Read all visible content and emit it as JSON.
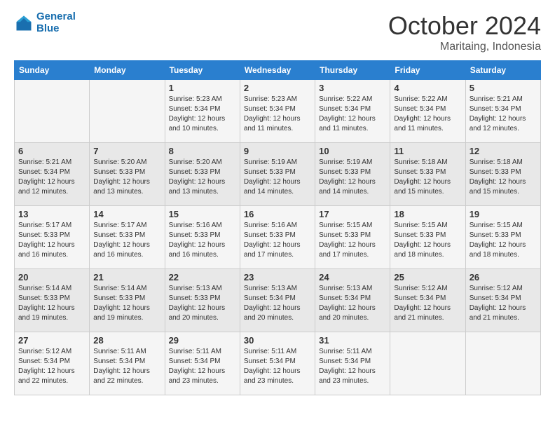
{
  "header": {
    "logo_line1": "General",
    "logo_line2": "Blue",
    "month": "October 2024",
    "location": "Maritaing, Indonesia"
  },
  "weekdays": [
    "Sunday",
    "Monday",
    "Tuesday",
    "Wednesday",
    "Thursday",
    "Friday",
    "Saturday"
  ],
  "weeks": [
    [
      {
        "day": "",
        "sunrise": "",
        "sunset": "",
        "daylight": ""
      },
      {
        "day": "",
        "sunrise": "",
        "sunset": "",
        "daylight": ""
      },
      {
        "day": "1",
        "sunrise": "Sunrise: 5:23 AM",
        "sunset": "Sunset: 5:34 PM",
        "daylight": "Daylight: 12 hours and 10 minutes."
      },
      {
        "day": "2",
        "sunrise": "Sunrise: 5:23 AM",
        "sunset": "Sunset: 5:34 PM",
        "daylight": "Daylight: 12 hours and 11 minutes."
      },
      {
        "day": "3",
        "sunrise": "Sunrise: 5:22 AM",
        "sunset": "Sunset: 5:34 PM",
        "daylight": "Daylight: 12 hours and 11 minutes."
      },
      {
        "day": "4",
        "sunrise": "Sunrise: 5:22 AM",
        "sunset": "Sunset: 5:34 PM",
        "daylight": "Daylight: 12 hours and 11 minutes."
      },
      {
        "day": "5",
        "sunrise": "Sunrise: 5:21 AM",
        "sunset": "Sunset: 5:34 PM",
        "daylight": "Daylight: 12 hours and 12 minutes."
      }
    ],
    [
      {
        "day": "6",
        "sunrise": "Sunrise: 5:21 AM",
        "sunset": "Sunset: 5:34 PM",
        "daylight": "Daylight: 12 hours and 12 minutes."
      },
      {
        "day": "7",
        "sunrise": "Sunrise: 5:20 AM",
        "sunset": "Sunset: 5:33 PM",
        "daylight": "Daylight: 12 hours and 13 minutes."
      },
      {
        "day": "8",
        "sunrise": "Sunrise: 5:20 AM",
        "sunset": "Sunset: 5:33 PM",
        "daylight": "Daylight: 12 hours and 13 minutes."
      },
      {
        "day": "9",
        "sunrise": "Sunrise: 5:19 AM",
        "sunset": "Sunset: 5:33 PM",
        "daylight": "Daylight: 12 hours and 14 minutes."
      },
      {
        "day": "10",
        "sunrise": "Sunrise: 5:19 AM",
        "sunset": "Sunset: 5:33 PM",
        "daylight": "Daylight: 12 hours and 14 minutes."
      },
      {
        "day": "11",
        "sunrise": "Sunrise: 5:18 AM",
        "sunset": "Sunset: 5:33 PM",
        "daylight": "Daylight: 12 hours and 15 minutes."
      },
      {
        "day": "12",
        "sunrise": "Sunrise: 5:18 AM",
        "sunset": "Sunset: 5:33 PM",
        "daylight": "Daylight: 12 hours and 15 minutes."
      }
    ],
    [
      {
        "day": "13",
        "sunrise": "Sunrise: 5:17 AM",
        "sunset": "Sunset: 5:33 PM",
        "daylight": "Daylight: 12 hours and 16 minutes."
      },
      {
        "day": "14",
        "sunrise": "Sunrise: 5:17 AM",
        "sunset": "Sunset: 5:33 PM",
        "daylight": "Daylight: 12 hours and 16 minutes."
      },
      {
        "day": "15",
        "sunrise": "Sunrise: 5:16 AM",
        "sunset": "Sunset: 5:33 PM",
        "daylight": "Daylight: 12 hours and 16 minutes."
      },
      {
        "day": "16",
        "sunrise": "Sunrise: 5:16 AM",
        "sunset": "Sunset: 5:33 PM",
        "daylight": "Daylight: 12 hours and 17 minutes."
      },
      {
        "day": "17",
        "sunrise": "Sunrise: 5:15 AM",
        "sunset": "Sunset: 5:33 PM",
        "daylight": "Daylight: 12 hours and 17 minutes."
      },
      {
        "day": "18",
        "sunrise": "Sunrise: 5:15 AM",
        "sunset": "Sunset: 5:33 PM",
        "daylight": "Daylight: 12 hours and 18 minutes."
      },
      {
        "day": "19",
        "sunrise": "Sunrise: 5:15 AM",
        "sunset": "Sunset: 5:33 PM",
        "daylight": "Daylight: 12 hours and 18 minutes."
      }
    ],
    [
      {
        "day": "20",
        "sunrise": "Sunrise: 5:14 AM",
        "sunset": "Sunset: 5:33 PM",
        "daylight": "Daylight: 12 hours and 19 minutes."
      },
      {
        "day": "21",
        "sunrise": "Sunrise: 5:14 AM",
        "sunset": "Sunset: 5:33 PM",
        "daylight": "Daylight: 12 hours and 19 minutes."
      },
      {
        "day": "22",
        "sunrise": "Sunrise: 5:13 AM",
        "sunset": "Sunset: 5:33 PM",
        "daylight": "Daylight: 12 hours and 20 minutes."
      },
      {
        "day": "23",
        "sunrise": "Sunrise: 5:13 AM",
        "sunset": "Sunset: 5:34 PM",
        "daylight": "Daylight: 12 hours and 20 minutes."
      },
      {
        "day": "24",
        "sunrise": "Sunrise: 5:13 AM",
        "sunset": "Sunset: 5:34 PM",
        "daylight": "Daylight: 12 hours and 20 minutes."
      },
      {
        "day": "25",
        "sunrise": "Sunrise: 5:12 AM",
        "sunset": "Sunset: 5:34 PM",
        "daylight": "Daylight: 12 hours and 21 minutes."
      },
      {
        "day": "26",
        "sunrise": "Sunrise: 5:12 AM",
        "sunset": "Sunset: 5:34 PM",
        "daylight": "Daylight: 12 hours and 21 minutes."
      }
    ],
    [
      {
        "day": "27",
        "sunrise": "Sunrise: 5:12 AM",
        "sunset": "Sunset: 5:34 PM",
        "daylight": "Daylight: 12 hours and 22 minutes."
      },
      {
        "day": "28",
        "sunrise": "Sunrise: 5:11 AM",
        "sunset": "Sunset: 5:34 PM",
        "daylight": "Daylight: 12 hours and 22 minutes."
      },
      {
        "day": "29",
        "sunrise": "Sunrise: 5:11 AM",
        "sunset": "Sunset: 5:34 PM",
        "daylight": "Daylight: 12 hours and 23 minutes."
      },
      {
        "day": "30",
        "sunrise": "Sunrise: 5:11 AM",
        "sunset": "Sunset: 5:34 PM",
        "daylight": "Daylight: 12 hours and 23 minutes."
      },
      {
        "day": "31",
        "sunrise": "Sunrise: 5:11 AM",
        "sunset": "Sunset: 5:34 PM",
        "daylight": "Daylight: 12 hours and 23 minutes."
      },
      {
        "day": "",
        "sunrise": "",
        "sunset": "",
        "daylight": ""
      },
      {
        "day": "",
        "sunrise": "",
        "sunset": "",
        "daylight": ""
      }
    ]
  ]
}
